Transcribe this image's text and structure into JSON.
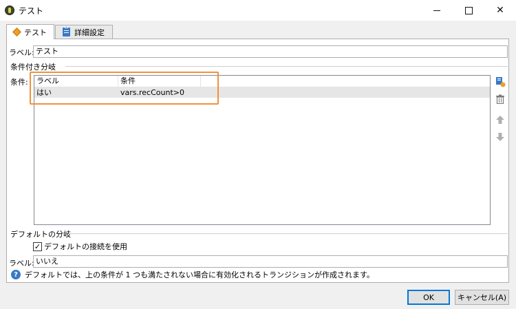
{
  "window": {
    "title": "テスト"
  },
  "tabs": [
    {
      "label": "テスト"
    },
    {
      "label": "詳細設定"
    }
  ],
  "label_field": {
    "caption": "ラベル:",
    "value": "テスト"
  },
  "conditional_group": {
    "title": "条件付き分岐"
  },
  "conditions": {
    "caption": "条件:",
    "columns": [
      "ラベル",
      "条件"
    ],
    "rows": [
      {
        "label": "はい",
        "condition": "vars.recCount>0"
      }
    ]
  },
  "default_group": {
    "title": "デフォルトの分岐"
  },
  "default_checkbox": {
    "label": "デフォルトの接続を使用",
    "checked": true
  },
  "default_label": {
    "caption": "ラベル:",
    "value": "いいえ"
  },
  "help_text": "デフォルトでは、上の条件が 1 つも満たされない場合に有効化されるトランジションが作成されます。",
  "buttons": {
    "ok": "OK",
    "cancel": "キャンセル(A)"
  },
  "colors": {
    "highlight": "#f0913a",
    "accent": "#0078d7",
    "tab_icon": "#f0a020"
  }
}
